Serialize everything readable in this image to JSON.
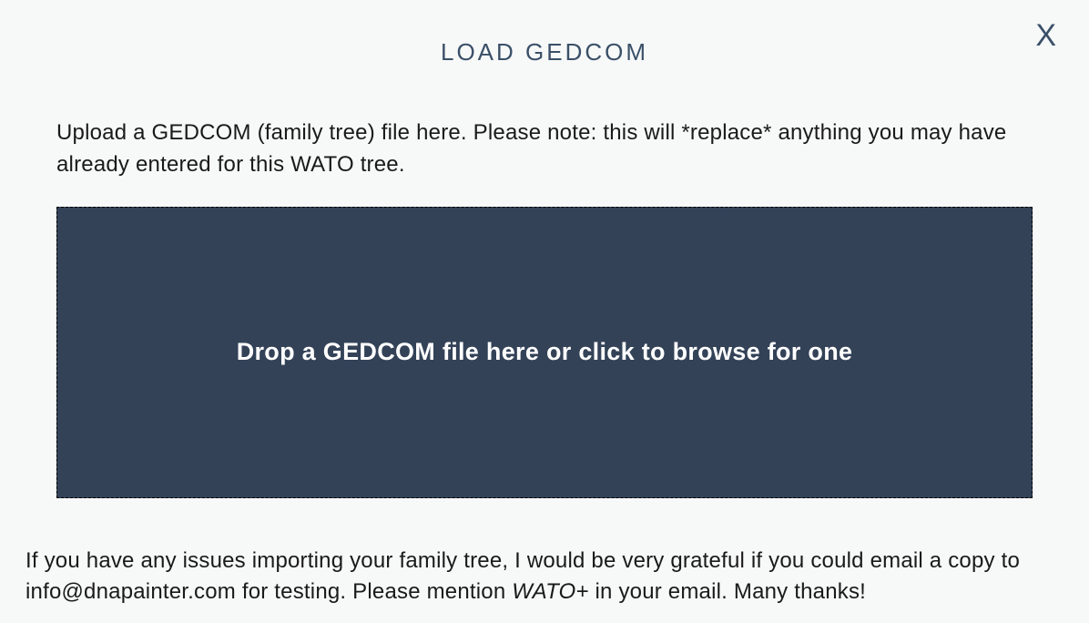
{
  "modal": {
    "title": "LOAD GEDCOM",
    "close_label": "X",
    "intro_text": "Upload a GEDCOM (family tree) file here. Please note: this will *replace* anything you may have already entered for this WATO tree.",
    "dropzone_text": "Drop a GEDCOM file here or click to browse for one",
    "footer_prefix": "If you have any issues importing your family tree, I would be very grateful if you could email a copy to info@dnapainter.com for testing. Please mention ",
    "footer_emph": "WATO+",
    "footer_suffix": " in your email. Many thanks!"
  }
}
